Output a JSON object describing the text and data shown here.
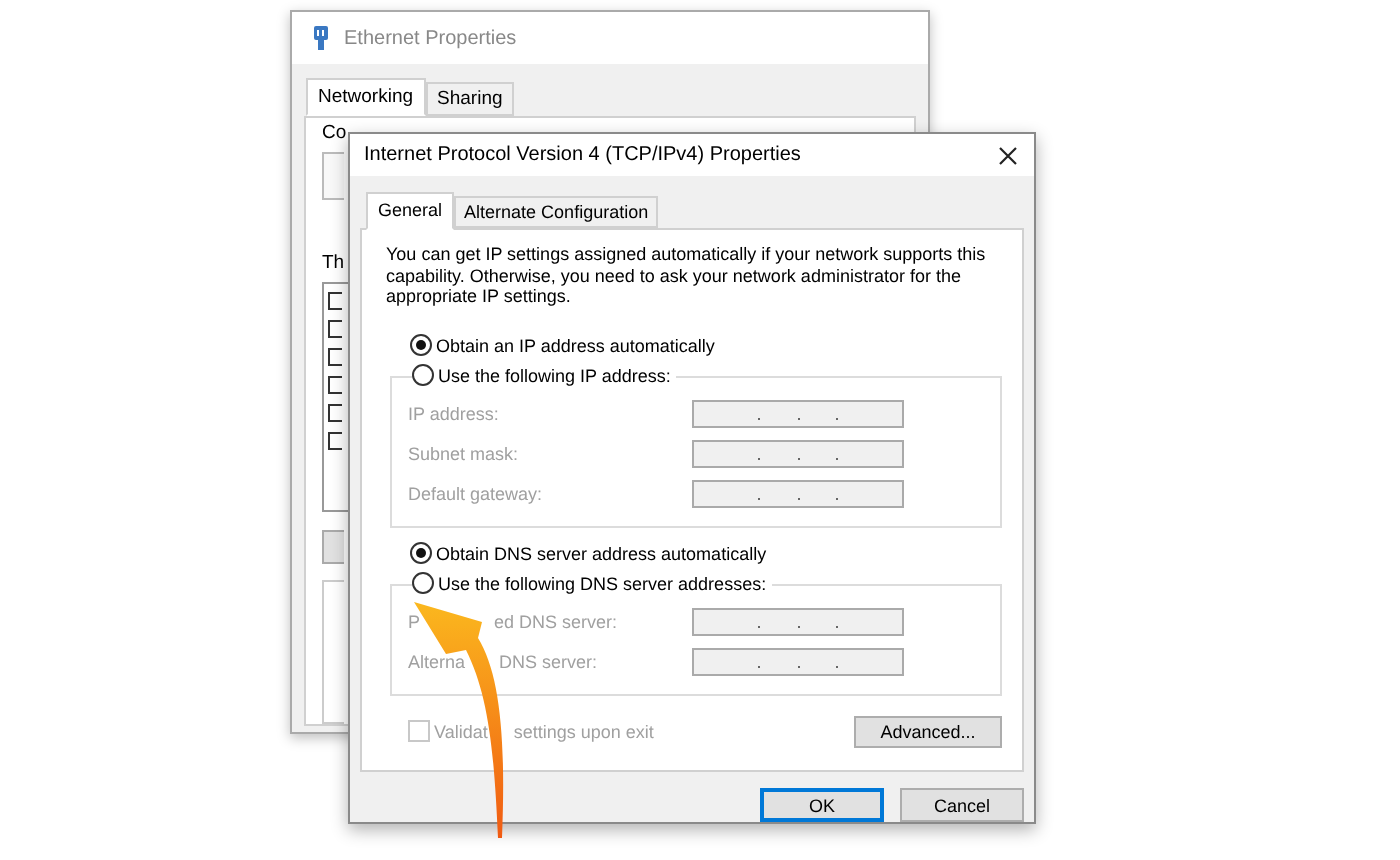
{
  "back_window": {
    "title": "Ethernet Properties",
    "tabs": [
      {
        "label": "Networking",
        "selected": true
      },
      {
        "label": "Sharing",
        "selected": false
      }
    ],
    "partial_labels": [
      "Co",
      "Th"
    ]
  },
  "dialog": {
    "title": "Internet Protocol Version 4 (TCP/IPv4) Properties",
    "tabs": [
      {
        "label": "General",
        "selected": true
      },
      {
        "label": "Alternate Configuration",
        "selected": false
      }
    ],
    "description": "You can get IP settings assigned automatically if your network supports this capability. Otherwise, you need to ask your network administrator for the appropriate IP settings.",
    "ip_options": [
      {
        "label": "Obtain an IP address automatically",
        "selected": true
      },
      {
        "label": "Use the following IP address:",
        "selected": false
      }
    ],
    "ip_fields": [
      {
        "label_parts": [
          "IP address:"
        ],
        "disabled": true
      },
      {
        "label_parts": [
          "Subnet mask:"
        ],
        "disabled": true
      },
      {
        "label_parts": [
          "Default gateway:"
        ],
        "disabled": true
      }
    ],
    "dns_options": [
      {
        "label": "Obtain DNS server address automatically",
        "selected": true
      },
      {
        "label": "Use the following DNS server addresses:",
        "selected": false
      }
    ],
    "dns_fields": [
      {
        "label_parts": [
          "P",
          "ed DNS server:"
        ],
        "disabled": true
      },
      {
        "label_parts": [
          "Alterna",
          "DNS server:"
        ],
        "disabled": true
      }
    ],
    "validate": {
      "label_parts": [
        "Validat",
        "settings upon exit"
      ],
      "checked": false,
      "disabled": true
    },
    "advanced_button": "Advanced...",
    "buttons": [
      {
        "label": "OK",
        "default": true
      },
      {
        "label": "Cancel",
        "default": false
      }
    ]
  }
}
